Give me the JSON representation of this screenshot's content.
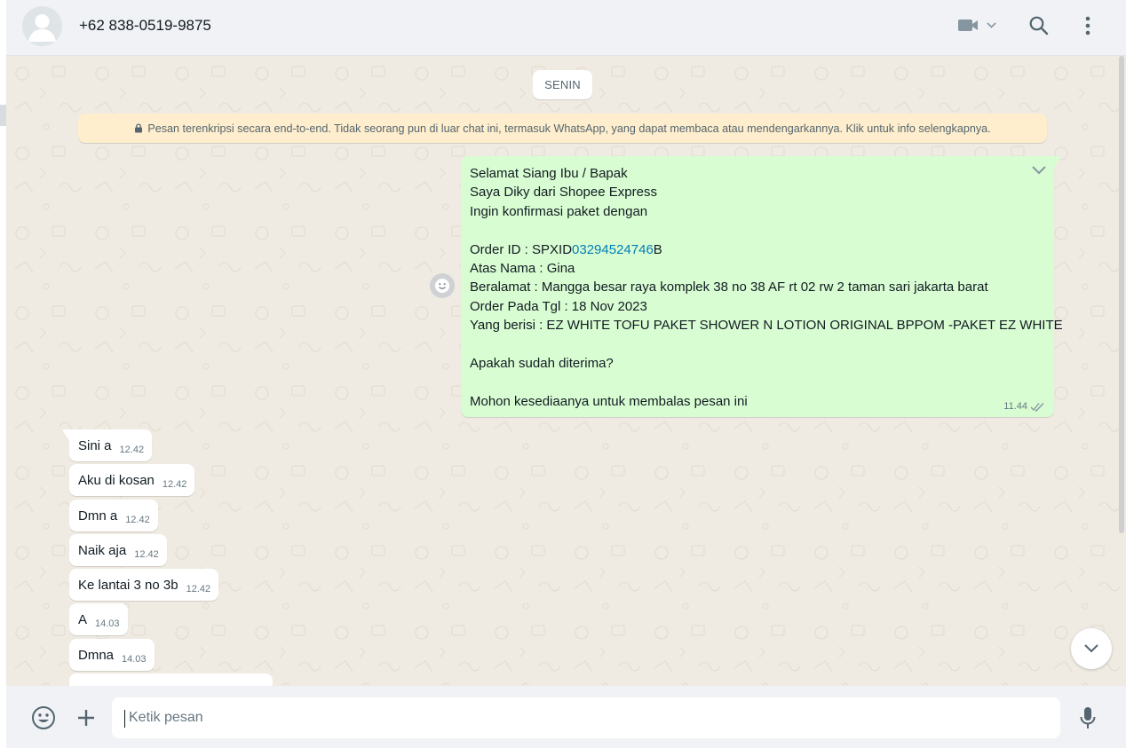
{
  "header": {
    "contact_name": "+62 838-0519-9875",
    "icons": [
      "default-avatar-icon",
      "video-call-icon",
      "search-icon",
      "menu-icon"
    ]
  },
  "chat": {
    "date_chip": "SENIN",
    "encryption_notice": "Pesan terenkripsi secara end-to-end. Tidak seorang pun di luar chat ini, termasuk WhatsApp, yang dapat membaca atau mendengarkannya. Klik untuk info selengkapnya.",
    "outgoing": {
      "lines": [
        "Selamat Siang Ibu / Bapak",
        "Saya Diky dari Shopee Express",
        "Ingin konfirmasi paket dengan",
        "",
        "",
        "Atas Nama : Gina",
        "Beralamat : Mangga besar raya komplek 38 no 38 AF rt 02 rw 2 taman sari jakarta barat",
        "Order Pada Tgl : 18 Nov 2023",
        "Yang berisi : EZ WHITE TOFU PAKET SHOWER N LOTION ORIGINAL BPPOM -PAKET EZ WHITE",
        "",
        "Apakah sudah diterima?",
        "",
        "Mohon kesediaanya untuk membalas pesan ini"
      ],
      "order_prefix": "Order ID : SPXID",
      "order_number": "03294524746",
      "order_suffix": "B",
      "time": "11.44",
      "status": "read"
    },
    "incoming": [
      {
        "text": "Sini a",
        "time": "12.42"
      },
      {
        "text": "Aku di kosan",
        "time": "12.42"
      },
      {
        "text": "Dmn a",
        "time": "12.42"
      },
      {
        "text": "Naik aja",
        "time": "12.42"
      },
      {
        "text": "Ke lantai 3 no 3b",
        "time": "12.42"
      },
      {
        "text": "A",
        "time": "14.03"
      },
      {
        "text": "Dmna",
        "time": "14.03"
      }
    ]
  },
  "footer": {
    "input_placeholder": "Ketik pesan"
  },
  "colors": {
    "chat_bg": "#efeae2",
    "outgoing_bubble": "#d9fdd3",
    "incoming_bubble": "#ffffff",
    "link": "#027eb5",
    "notice_bg": "#ffeecd"
  }
}
